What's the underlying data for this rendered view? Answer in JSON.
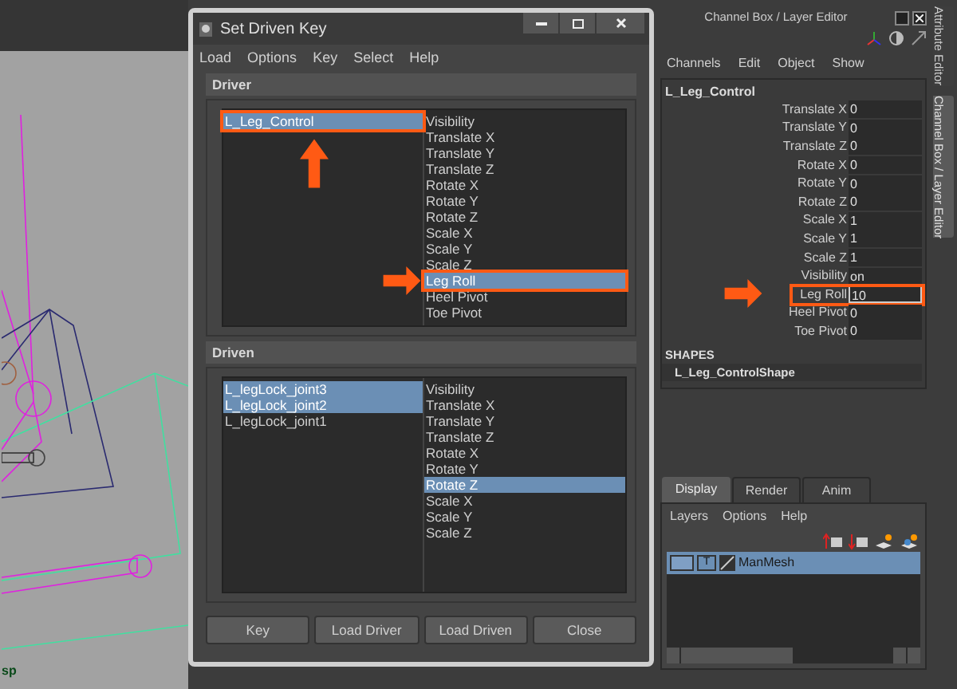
{
  "viewport": {
    "label": "sp"
  },
  "dialog": {
    "title": "Set Driven Key",
    "menu": [
      "Load",
      "Options",
      "Key",
      "Select",
      "Help"
    ],
    "driver": {
      "heading": "Driver",
      "objects": [
        {
          "label": "L_Leg_Control",
          "selected": true,
          "highlighted": true
        }
      ],
      "attributes": [
        {
          "label": "Visibility",
          "selected": false,
          "highlighted": false
        },
        {
          "label": "Translate X",
          "selected": false,
          "highlighted": false
        },
        {
          "label": "Translate Y",
          "selected": false,
          "highlighted": false
        },
        {
          "label": "Translate Z",
          "selected": false,
          "highlighted": false
        },
        {
          "label": "Rotate X",
          "selected": false,
          "highlighted": false
        },
        {
          "label": "Rotate Y",
          "selected": false,
          "highlighted": false
        },
        {
          "label": "Rotate Z",
          "selected": false,
          "highlighted": false
        },
        {
          "label": "Scale X",
          "selected": false,
          "highlighted": false
        },
        {
          "label": "Scale Y",
          "selected": false,
          "highlighted": false
        },
        {
          "label": "Scale Z",
          "selected": false,
          "highlighted": false
        },
        {
          "label": "Leg Roll",
          "selected": true,
          "highlighted": true
        },
        {
          "label": "Heel Pivot",
          "selected": false,
          "highlighted": false
        },
        {
          "label": "Toe Pivot",
          "selected": false,
          "highlighted": false
        }
      ]
    },
    "driven": {
      "heading": "Driven",
      "objects": [
        {
          "label": "L_legLock_joint3",
          "selected": true,
          "highlighted": false
        },
        {
          "label": "L_legLock_joint2",
          "selected": true,
          "highlighted": false
        },
        {
          "label": "L_legLock_joint1",
          "selected": false,
          "highlighted": false
        }
      ],
      "attributes": [
        {
          "label": "Visibility",
          "selected": false,
          "highlighted": false
        },
        {
          "label": "Translate X",
          "selected": false,
          "highlighted": false
        },
        {
          "label": "Translate Y",
          "selected": false,
          "highlighted": false
        },
        {
          "label": "Translate Z",
          "selected": false,
          "highlighted": false
        },
        {
          "label": "Rotate X",
          "selected": false,
          "highlighted": false
        },
        {
          "label": "Rotate Y",
          "selected": false,
          "highlighted": false
        },
        {
          "label": "Rotate Z",
          "selected": true,
          "highlighted": false
        },
        {
          "label": "Scale X",
          "selected": false,
          "highlighted": false
        },
        {
          "label": "Scale Y",
          "selected": false,
          "highlighted": false
        },
        {
          "label": "Scale Z",
          "selected": false,
          "highlighted": false
        }
      ]
    },
    "buttons": [
      "Key",
      "Load Driver",
      "Load Driven",
      "Close"
    ]
  },
  "channel_box": {
    "title": "Channel Box / Layer Editor",
    "menu": [
      "Channels",
      "Edit",
      "Object",
      "Show"
    ],
    "object": "L_Leg_Control",
    "channels": [
      {
        "name": "Translate X",
        "value": "0",
        "highlighted": false
      },
      {
        "name": "Translate Y",
        "value": "0",
        "highlighted": false
      },
      {
        "name": "Translate Z",
        "value": "0",
        "highlighted": false
      },
      {
        "name": "Rotate X",
        "value": "0",
        "highlighted": false
      },
      {
        "name": "Rotate Y",
        "value": "0",
        "highlighted": false
      },
      {
        "name": "Rotate Z",
        "value": "0",
        "highlighted": false
      },
      {
        "name": "Scale X",
        "value": "1",
        "highlighted": false
      },
      {
        "name": "Scale Y",
        "value": "1",
        "highlighted": false
      },
      {
        "name": "Scale Z",
        "value": "1",
        "highlighted": false
      },
      {
        "name": "Visibility",
        "value": "on",
        "highlighted": false
      },
      {
        "name": "Leg Roll",
        "value": "10",
        "highlighted": true
      },
      {
        "name": "Heel Pivot",
        "value": "0",
        "highlighted": false
      },
      {
        "name": "Toe Pivot",
        "value": "0",
        "highlighted": false
      }
    ],
    "shapes_heading": "SHAPES",
    "shape": "L_Leg_ControlShape"
  },
  "layer_editor": {
    "tabs": [
      {
        "label": "Display",
        "selected": true
      },
      {
        "label": "Render",
        "selected": false
      },
      {
        "label": "Anim",
        "selected": false
      }
    ],
    "menu": [
      "Layers",
      "Options",
      "Help"
    ],
    "layers": [
      {
        "name": "ManMesh",
        "type": "T",
        "selected": true
      }
    ]
  },
  "side_tabs": [
    {
      "label": "Attribute Editor",
      "selected": false
    },
    {
      "label": "Channel Box / Layer Editor",
      "selected": true
    }
  ]
}
